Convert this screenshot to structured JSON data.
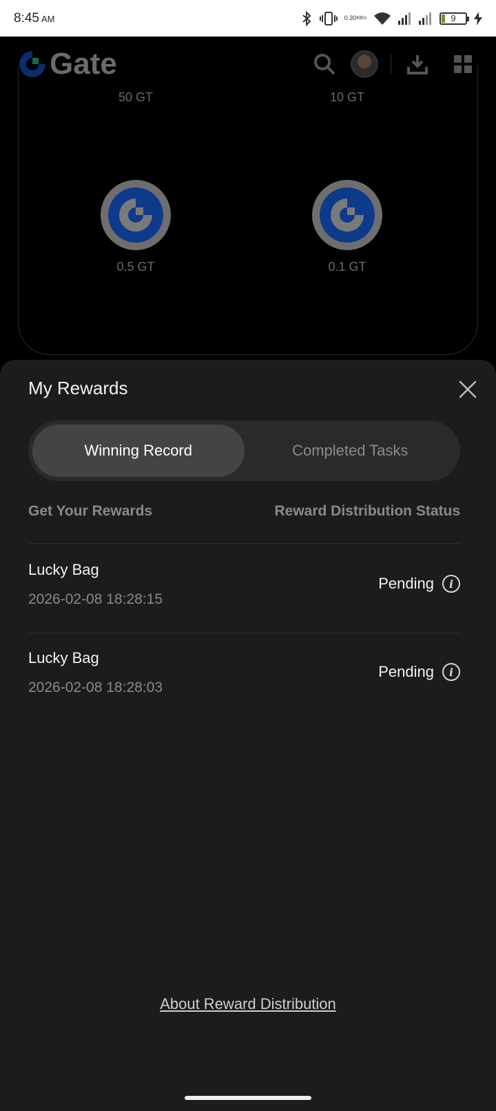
{
  "status_bar": {
    "time": "8:45",
    "ampm": "AM",
    "net_speed_value": "0.30",
    "net_speed_unit": "KB/s",
    "battery": "9",
    "icons": [
      "bluetooth-icon",
      "vibrate-icon",
      "wifi-icon",
      "signal-icon",
      "signal-icon",
      "battery-icon",
      "charging-icon"
    ]
  },
  "header": {
    "logo_text": "Gate",
    "icons": [
      "search-icon",
      "avatar",
      "download-icon",
      "grid-icon"
    ]
  },
  "prizes": [
    {
      "label": "50 GT"
    },
    {
      "label": "10 GT"
    },
    {
      "label": "0.5 GT"
    },
    {
      "label": "0.1 GT"
    }
  ],
  "sheet": {
    "title": "My Rewards",
    "tabs": [
      {
        "label": "Winning Record",
        "active": true
      },
      {
        "label": "Completed Tasks",
        "active": false
      }
    ],
    "columns": {
      "left": "Get Your Rewards",
      "right": "Reward Distribution Status"
    },
    "records": [
      {
        "title": "Lucky Bag",
        "date": "2026-02-08 18:28:15",
        "status": "Pending"
      },
      {
        "title": "Lucky Bag",
        "date": "2026-02-08 18:28:03",
        "status": "Pending"
      }
    ],
    "footer_link": "About Reward Distribution"
  },
  "colors": {
    "sheet_bg": "#1c1c1c",
    "active_tab": "#444444",
    "brand_blue": "#0d3a8a"
  }
}
